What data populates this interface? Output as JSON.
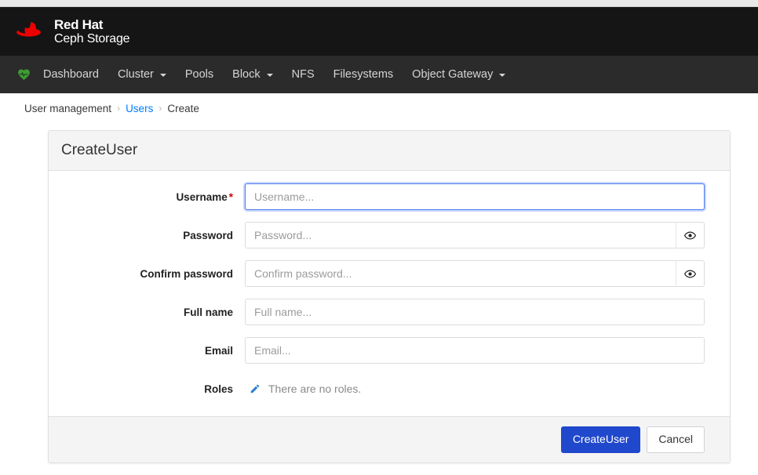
{
  "brand": {
    "line1": "Red Hat",
    "line2": "Ceph Storage",
    "logo_color": "#ee0000"
  },
  "navbar": {
    "health_icon": "heart-pulse-icon",
    "health_color": "#3f9c35",
    "items": [
      {
        "label": "Dashboard",
        "has_caret": false
      },
      {
        "label": "Cluster",
        "has_caret": true
      },
      {
        "label": "Pools",
        "has_caret": false
      },
      {
        "label": "Block",
        "has_caret": true
      },
      {
        "label": "NFS",
        "has_caret": false
      },
      {
        "label": "Filesystems",
        "has_caret": false
      },
      {
        "label": "Object Gateway",
        "has_caret": true
      }
    ]
  },
  "breadcrumb": {
    "root": "User management",
    "separator": "›",
    "link": "Users",
    "current": "Create"
  },
  "card": {
    "title": "CreateUser",
    "fields": [
      {
        "label": "Username",
        "required": true,
        "required_marker": "*",
        "placeholder": "Username...",
        "value": "",
        "focused": true,
        "addon": null
      },
      {
        "label": "Password",
        "required": false,
        "required_marker": "",
        "placeholder": "Password...",
        "value": "",
        "focused": false,
        "addon": "eye-icon"
      },
      {
        "label": "Confirm password",
        "required": false,
        "required_marker": "",
        "placeholder": "Confirm password...",
        "value": "",
        "focused": false,
        "addon": "eye-icon"
      },
      {
        "label": "Full name",
        "required": false,
        "required_marker": "",
        "placeholder": "Full name...",
        "value": "",
        "focused": false,
        "addon": null
      },
      {
        "label": "Email",
        "required": false,
        "required_marker": "",
        "placeholder": "Email...",
        "value": "",
        "focused": false,
        "addon": null
      }
    ],
    "roles": {
      "label": "Roles",
      "edit_icon": "pencil-icon",
      "edit_icon_color": "#2b7dd6",
      "empty_text": "There are no roles."
    },
    "footer": {
      "submit_label": "CreateUser",
      "cancel_label": "Cancel",
      "primary_color": "#2048cc"
    }
  }
}
